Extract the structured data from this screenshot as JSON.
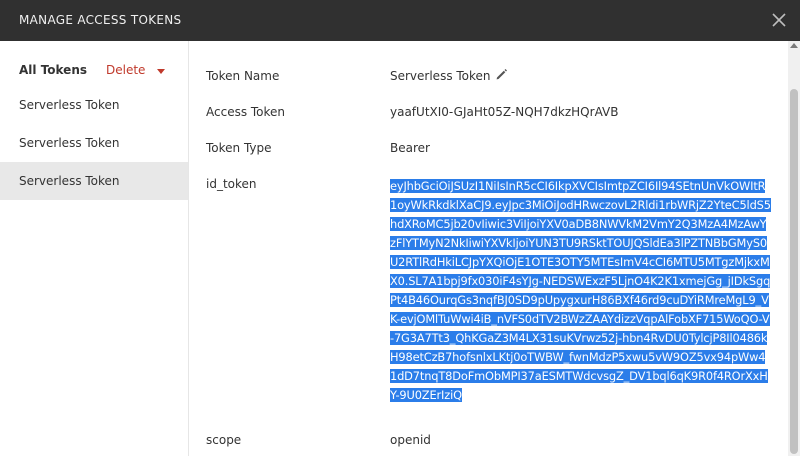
{
  "dialog": {
    "title": "MANAGE ACCESS TOKENS",
    "close_icon": "close-icon"
  },
  "sidebar": {
    "all_tokens_label": "All Tokens",
    "delete_label": "Delete",
    "items": [
      {
        "label": "Serverless Token",
        "selected": false
      },
      {
        "label": "Serverless Token",
        "selected": false
      },
      {
        "label": "Serverless Token",
        "selected": true
      }
    ]
  },
  "details": {
    "token_name_label": "Token Name",
    "token_name_value": "Serverless Token",
    "access_token_label": "Access Token",
    "access_token_value": "yaafUtXI0-GJaHt05Z-NQH7dkzHQrAVB",
    "token_type_label": "Token Type",
    "token_type_value": "Bearer",
    "id_token_label": "id_token",
    "id_token_value": "eyJhbGciOiJSUzI1NiIsInR5cCI6IkpXVCIsImtpZCI6Il94SEtnUnVkOWItR1oyWkRkdklXaCJ9.eyJpc3MiOiJodHRwczovL2Rldi1rbWRjZ2YteC5ldS5hdXRoMC5jb20vIiwic3ViIjoiYXV0aDB8NWVkM2VmY2Q3MzA4MzAwYzFlYTMyN2NkIiwiYXVkIjoiYUN3TU9RSktTOUJQSldEa3lPZTNBbGMyS0U2RTlRdHkiLCJpYXQiOjE1OTE3OTY5MTEsImV4cCI6MTU5MTgzMjkxMX0.SL7A1bpj9fx030iF4sYJg-NEDSWExzF5LjnO4K2K1xmejGg_jIDkSgqPt4B46OurqGs3nqfBJ0SD9pUpygxurH86BXf46rd9cuDYiRMreMgL9_VK-evjOMlTuWwi4iB_nVFS0dTV2BWzZAAYdizzVqpAlFobXF715WoQO-V-7G3A7Tt3_QhKGaZ3M4LX31suKVrwz52j-hbn4RvDU0TylcjP8Il0486kH98etCzB7hofsnlxLKtj0oTWBW_fwnMdzP5xwu5vW9OZ5vx94pWw41dD7tnqT8DoFmObMPI37aESMTWdcvsgZ_DV1bql6qK9R0f4ROrXxHY-9U0ZErIziQ",
    "scope_label": "scope",
    "scope_value": "openid"
  },
  "colors": {
    "titlebar_bg": "#303030",
    "delete_accent": "#c0392b",
    "selection_bg": "#2b7de9",
    "selected_item_bg": "#e8e8e8"
  }
}
